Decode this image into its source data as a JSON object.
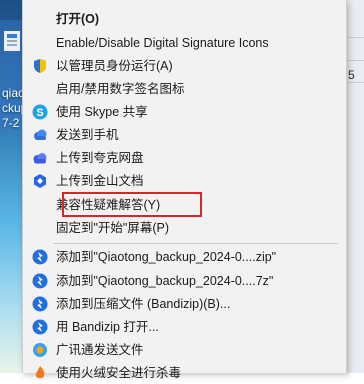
{
  "desktop": {
    "icon_labels": [
      "qiaoto",
      "ckup",
      "7-2"
    ]
  },
  "right_strip": {
    "label": "5"
  },
  "menu": {
    "items": [
      {
        "label": "打开(O)",
        "icon": "none",
        "bold": true
      },
      {
        "label": "Enable/Disable Digital Signature Icons",
        "icon": "none"
      },
      {
        "label": "以管理员身份运行(A)",
        "icon": "uac-shield-icon"
      },
      {
        "label": "启用/禁用数字签名图标",
        "icon": "none"
      },
      {
        "label": "使用 Skype 共享",
        "icon": "skype-icon"
      },
      {
        "label": "发送到手机",
        "icon": "cloud-blue-icon"
      },
      {
        "label": "上传到夸克网盘",
        "icon": "quark-cloud-icon"
      },
      {
        "label": "上传到金山文档",
        "icon": "kingsoft-docs-icon"
      },
      {
        "label": "兼容性疑难解答(Y)",
        "icon": "none"
      },
      {
        "label": "固定到\"开始\"屏幕(P)",
        "icon": "none"
      },
      {
        "label": "添加到\"Qiaotong_backup_2024-0....zip\"",
        "icon": "bandizip-icon"
      },
      {
        "label": "添加到\"Qiaotong_backup_2024-0....7z\"",
        "icon": "bandizip-icon"
      },
      {
        "label": "添加到压缩文件 (Bandizip)(B)...",
        "icon": "bandizip-icon"
      },
      {
        "label": "用 Bandizip 打开...",
        "icon": "bandizip-icon"
      },
      {
        "label": "广讯通发送文件",
        "icon": "guangxuntong-icon"
      },
      {
        "label": "使用火绒安全进行杀毒",
        "icon": "huorong-icon"
      }
    ],
    "highlight_color": "#d6262c"
  }
}
